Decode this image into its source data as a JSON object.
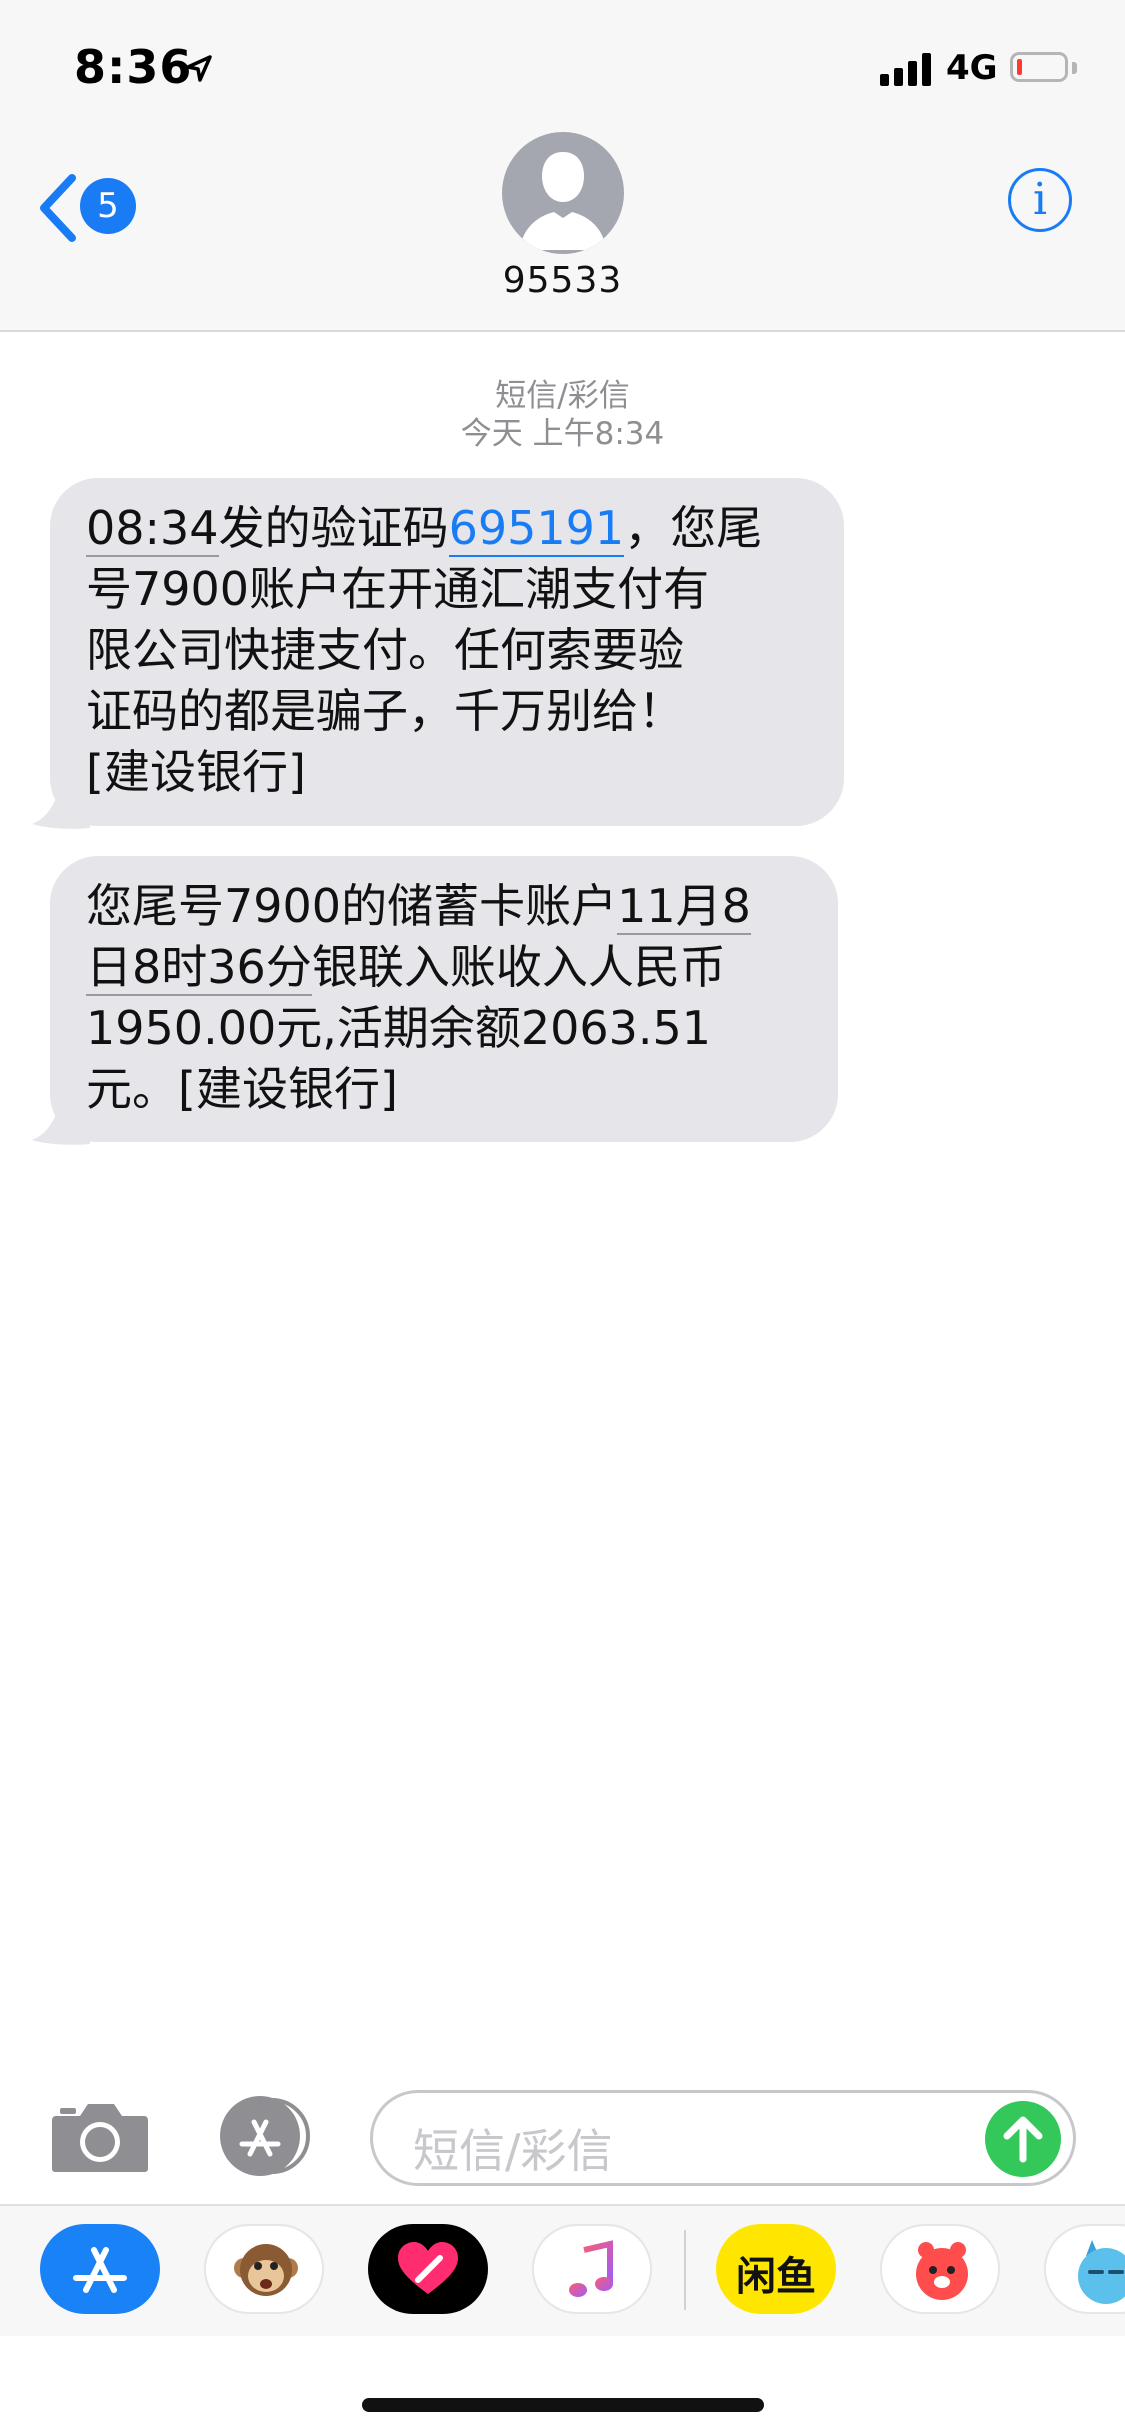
{
  "status_bar": {
    "time": "8:36",
    "network": "4G",
    "icons": [
      "location-arrow-icon",
      "signal-icon",
      "battery-icon"
    ],
    "battery_level": 0.05
  },
  "header": {
    "back_badge": "5",
    "contact_name": "95533",
    "icons": [
      "back-chevron-icon",
      "avatar-silhouette-icon",
      "info-icon"
    ]
  },
  "thread": {
    "channel_label": "短信/彩信",
    "timestamp": "今天 上午8:34",
    "messages": [
      {
        "from": "95533",
        "time_text": "08:34",
        "pre_code": "发的验证码",
        "code": "695191",
        "line1_tail": "，您尾",
        "line2": "号7900账户在开通汇潮支付有",
        "line3": "限公司快捷支付。任何索要验",
        "line4": "证码的都是骗子，千万别给！",
        "line5": "[建设银行]"
      },
      {
        "from": "95533",
        "line1_a": "您尾号7900的储蓄卡账户",
        "line1_b": "11月8",
        "line2_a": "日8时36分",
        "line2_b": "银联入账收入人民币",
        "line3": "1950.00元,活期余额2063.51",
        "line4": "元。[建设银行]"
      }
    ]
  },
  "compose": {
    "placeholder": "短信/彩信",
    "icons": [
      "camera-icon",
      "app-store-icon",
      "send-arrow-icon"
    ]
  },
  "app_drawer": {
    "apps": [
      {
        "name": "App Store",
        "icon": "app-store-icon",
        "color": "#1a82f7"
      },
      {
        "name": "Animoji",
        "icon": "monkey-icon",
        "color": "#ffffff"
      },
      {
        "name": "Digital Touch",
        "icon": "heart-icon",
        "color": "#000000"
      },
      {
        "name": "Music",
        "icon": "music-note-icon",
        "color": "#ffffff"
      },
      {
        "name": "闲鱼",
        "icon": "xianyu-icon",
        "color": "#ffe600",
        "label": "闲鱼"
      },
      {
        "name": "Sticker",
        "icon": "red-bear-icon",
        "color": "#ffffff"
      },
      {
        "name": "Sticker",
        "icon": "blue-monster-icon",
        "color": "#ffffff"
      }
    ]
  },
  "colors": {
    "accent": "#1a7cf5",
    "bubble": "#e5e5ea",
    "send": "#34c759",
    "meta_text": "#8e8e93"
  }
}
